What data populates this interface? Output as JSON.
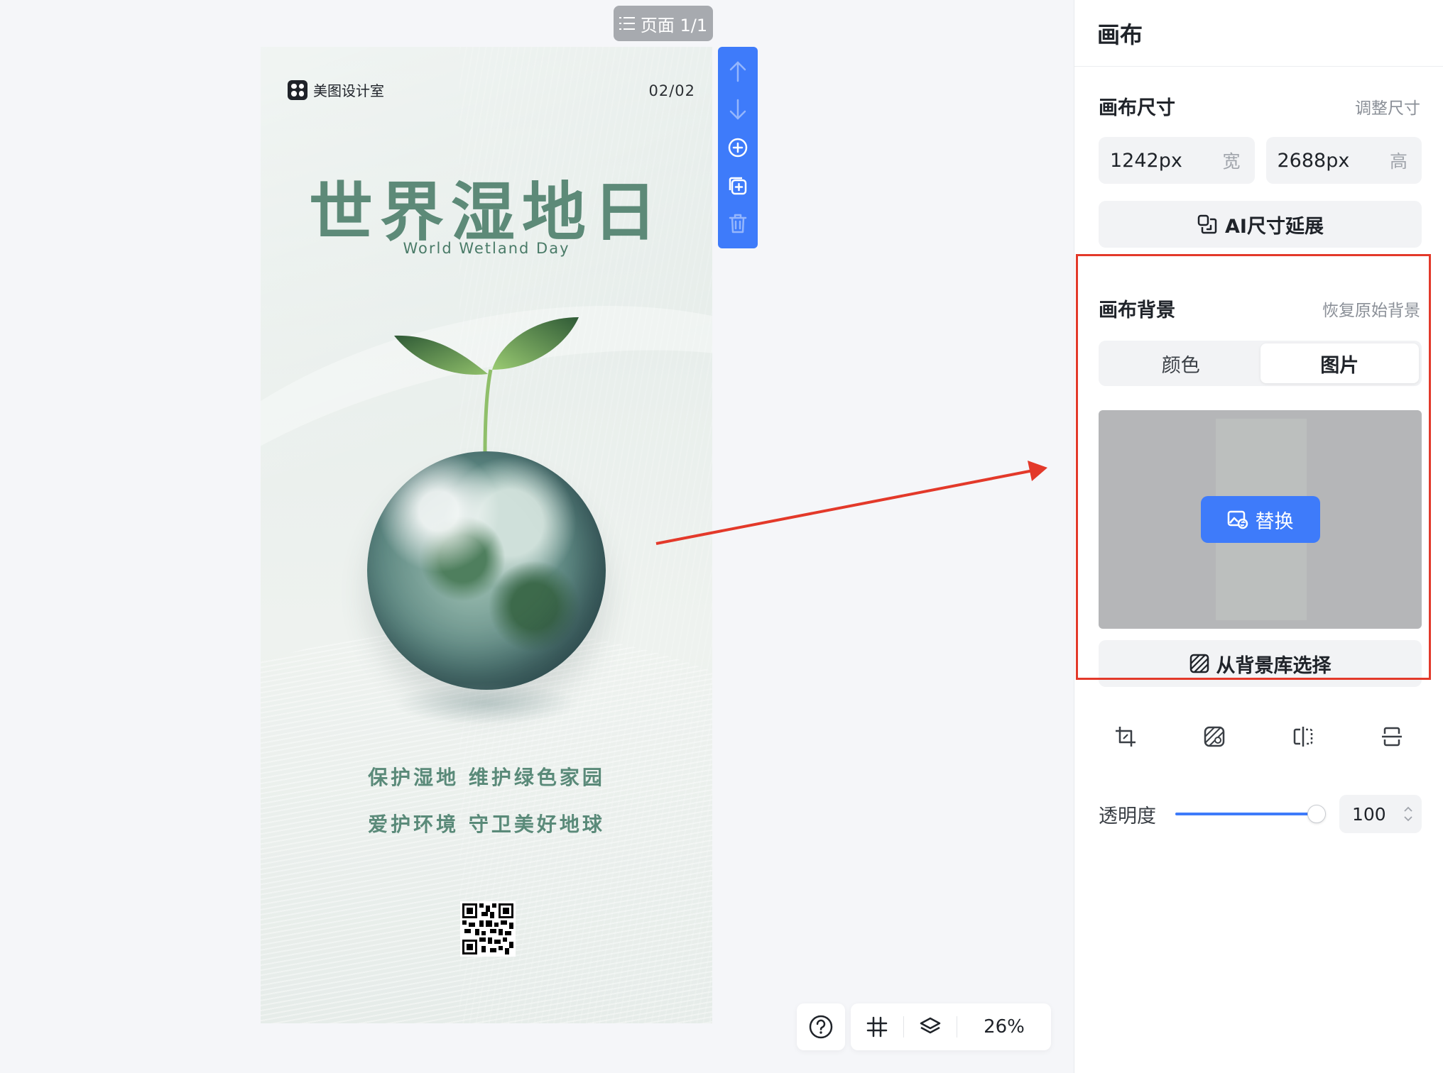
{
  "canvas": {
    "page_indicator": "页面 1/1",
    "zoom": "26%"
  },
  "poster": {
    "brand": "美图设计室",
    "page_number": "02/02",
    "title": "世界湿地日",
    "subtitle": "World Wetland Day",
    "slogan_line1": "保护湿地 维护绿色家园",
    "slogan_line2": "爱护环境 守卫美好地球"
  },
  "page_tools": [
    "arrow-up-icon",
    "arrow-down-icon",
    "add-page-icon",
    "duplicate-page-icon",
    "delete-page-icon"
  ],
  "panel": {
    "title": "画布",
    "size_section": {
      "title": "画布尺寸",
      "action": "调整尺寸",
      "width_value": "1242px",
      "width_unit": "宽",
      "height_value": "2688px",
      "height_unit": "高",
      "ai_button": "AI尺寸延展"
    },
    "background_section": {
      "title": "画布背景",
      "action": "恢复原始背景",
      "tabs": [
        {
          "label": "颜色",
          "active": false
        },
        {
          "label": "图片",
          "active": true
        }
      ],
      "replace_button": "替换",
      "library_button": "从背景库选择"
    },
    "image_tools": [
      "crop-icon",
      "matting-icon",
      "flip-horizontal-icon",
      "flip-vertical-icon"
    ],
    "opacity": {
      "label": "透明度",
      "value": "100",
      "fraction": 1.0
    }
  },
  "colors": {
    "accent": "#3e7bfa",
    "annotation": "#e3392a",
    "poster_green": "#5d8a78"
  }
}
